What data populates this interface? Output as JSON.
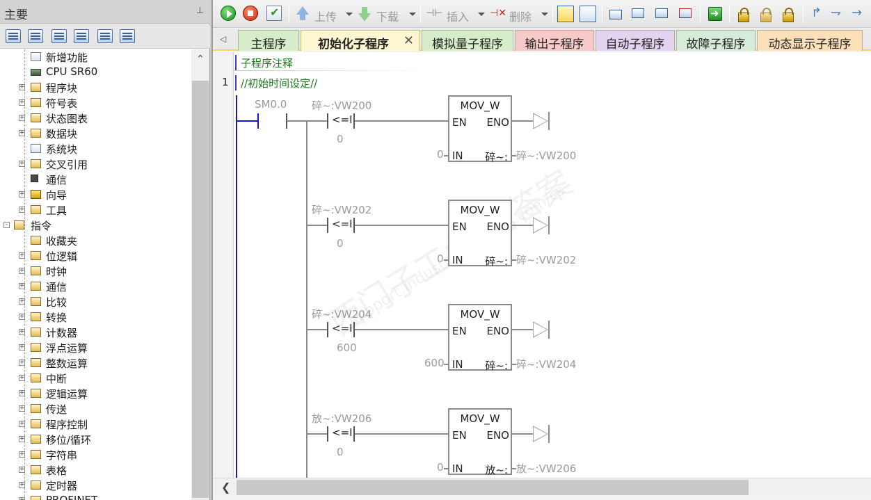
{
  "left_panel": {
    "title": "主要",
    "pin_icon": "pin-icon",
    "tree": [
      {
        "label": "新增功能",
        "depth": 2,
        "icon": "info"
      },
      {
        "label": "CPU SR60",
        "depth": 2,
        "icon": "cpu"
      },
      {
        "label": "程序块",
        "depth": 1,
        "icon": "folder",
        "expander": "+"
      },
      {
        "label": "符号表",
        "depth": 1,
        "icon": "folder",
        "expander": "+"
      },
      {
        "label": "状态图表",
        "depth": 1,
        "icon": "folder",
        "expander": "+"
      },
      {
        "label": "数据块",
        "depth": 1,
        "icon": "folder",
        "expander": "+"
      },
      {
        "label": "系统块",
        "depth": 2,
        "icon": "doc"
      },
      {
        "label": "交叉引用",
        "depth": 1,
        "icon": "folder",
        "expander": "+"
      },
      {
        "label": "通信",
        "depth": 2,
        "icon": "comm"
      },
      {
        "label": "向导",
        "depth": 1,
        "icon": "wizard",
        "expander": "+"
      },
      {
        "label": "工具",
        "depth": 1,
        "icon": "folder",
        "expander": "+"
      },
      {
        "label": "指令",
        "depth": 0,
        "icon": "folder",
        "expander": "-"
      },
      {
        "label": "收藏夹",
        "depth": 2,
        "icon": "folder"
      },
      {
        "label": "位逻辑",
        "depth": 1,
        "icon": "folder",
        "expander": "+"
      },
      {
        "label": "时钟",
        "depth": 1,
        "icon": "folder",
        "expander": "+"
      },
      {
        "label": "通信",
        "depth": 1,
        "icon": "folder",
        "expander": "+"
      },
      {
        "label": "比较",
        "depth": 1,
        "icon": "folder",
        "expander": "+"
      },
      {
        "label": "转换",
        "depth": 1,
        "icon": "folder",
        "expander": "+"
      },
      {
        "label": "计数器",
        "depth": 1,
        "icon": "folder",
        "expander": "+"
      },
      {
        "label": "浮点运算",
        "depth": 1,
        "icon": "folder",
        "expander": "+"
      },
      {
        "label": "整数运算",
        "depth": 1,
        "icon": "folder",
        "expander": "+"
      },
      {
        "label": "中断",
        "depth": 1,
        "icon": "folder",
        "expander": "+"
      },
      {
        "label": "逻辑运算",
        "depth": 1,
        "icon": "folder",
        "expander": "+"
      },
      {
        "label": "传送",
        "depth": 1,
        "icon": "folder",
        "expander": "+"
      },
      {
        "label": "程序控制",
        "depth": 1,
        "icon": "folder",
        "expander": "+"
      },
      {
        "label": "移位/循环",
        "depth": 1,
        "icon": "folder",
        "expander": "+"
      },
      {
        "label": "字符串",
        "depth": 1,
        "icon": "folder",
        "expander": "+"
      },
      {
        "label": "表格",
        "depth": 1,
        "icon": "folder",
        "expander": "+"
      },
      {
        "label": "定时器",
        "depth": 1,
        "icon": "folder",
        "expander": "+"
      },
      {
        "label": "PROFINET",
        "depth": 1,
        "icon": "folder",
        "expander": "+"
      }
    ]
  },
  "toolbar": {
    "upload_label": "上传",
    "download_label": "下载",
    "insert_label": "插入",
    "delete_label": "删除"
  },
  "tabs": [
    {
      "label": "主程序",
      "color": "#d7ecc8"
    },
    {
      "label": "初始化子程序",
      "color": "#fff7d2",
      "active": true
    },
    {
      "label": "模拟量子程序",
      "color": "#d7ecc8"
    },
    {
      "label": "输出子程序",
      "color": "#f7c9c9"
    },
    {
      "label": "自动子程序",
      "color": "#e3d3f1"
    },
    {
      "label": "故障子程序",
      "color": "#d7ecd8"
    },
    {
      "label": "动态显示子程序",
      "color": "#fde0b8"
    }
  ],
  "editor": {
    "subroutine_comment": "子程序注释",
    "network_number": "1",
    "network_comment": "//初始时间设定//",
    "contact_label": "SM0.0",
    "rungs": [
      {
        "compare_operand": "碎~:VW200",
        "compare_op": "<=I",
        "compare_value": "0",
        "box_title": "MOV_W",
        "en": "EN",
        "eno": "ENO",
        "in_label": "IN",
        "in_value": "0",
        "out_pin": "碎~:",
        "out_value": "碎~:VW200"
      },
      {
        "compare_operand": "碎~:VW202",
        "compare_op": "<=I",
        "compare_value": "0",
        "box_title": "MOV_W",
        "en": "EN",
        "eno": "ENO",
        "in_label": "IN",
        "in_value": "0",
        "out_pin": "碎~:",
        "out_value": "碎~:VW202"
      },
      {
        "compare_operand": "碎~:VW204",
        "compare_op": "<=I",
        "compare_value": "600",
        "box_title": "MOV_W",
        "en": "EN",
        "eno": "ENO",
        "in_label": "IN",
        "in_value": "600",
        "out_pin": "碎~:",
        "out_value": "碎~:VW204"
      },
      {
        "compare_operand": "放~:VW206",
        "compare_op": "<=I",
        "compare_value": "0",
        "box_title": "MOV_W",
        "en": "EN",
        "eno": "ENO",
        "in_label": "IN",
        "in_value": "0",
        "out_pin": "放~:",
        "out_value": "放~:VW206"
      }
    ],
    "watermark_cn": "西门子工业 找答案",
    "watermark_url": "support.industry.siemens.com/cs"
  }
}
